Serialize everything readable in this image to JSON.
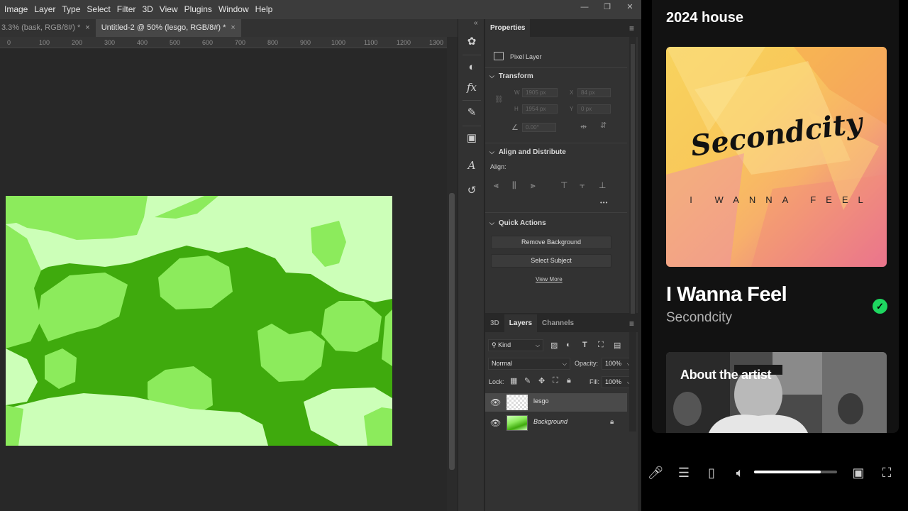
{
  "photoshop": {
    "menu": [
      "Image",
      "Layer",
      "Type",
      "Select",
      "Filter",
      "3D",
      "View",
      "Plugins",
      "Window",
      "Help"
    ],
    "window_controls": {
      "minimize": "—",
      "restore": "❐",
      "close": "✕"
    },
    "tabs": [
      {
        "label": "3.3% (bask, RGB/8#) *",
        "close": "×"
      },
      {
        "label": "Untitled-2 @ 50% (lesgo, RGB/8#) *",
        "close": "×"
      }
    ],
    "ruler_ticks": [
      "0",
      "100",
      "200",
      "300",
      "400",
      "500",
      "600",
      "700",
      "800",
      "900",
      "1000",
      "1100",
      "1200",
      "1300"
    ],
    "collapse_glyph": "«",
    "properties": {
      "tab": "Properties",
      "kind": "Pixel Layer",
      "transform": {
        "title": "Transform",
        "w_label": "W",
        "w_value": "1905 px",
        "h_label": "H",
        "h_value": "1954 px",
        "x_label": "X",
        "x_value": "84 px",
        "y_label": "Y",
        "y_value": "0 px",
        "angle_value": "0.00°"
      },
      "align": {
        "title": "Align and Distribute",
        "label": "Align:",
        "more": "•••"
      },
      "quick_actions": {
        "title": "Quick Actions",
        "remove_bg": "Remove Background",
        "select_subject": "Select Subject",
        "view_more": "View More"
      }
    },
    "layers_panel": {
      "tabs": [
        "3D",
        "Layers",
        "Channels"
      ],
      "active_tab": "Layers",
      "filter_kind": "Kind",
      "blend_mode": "Normal",
      "opacity_label": "Opacity:",
      "opacity_value": "100%",
      "lock_label": "Lock:",
      "fill_label": "Fill:",
      "fill_value": "100%",
      "layers": [
        {
          "name": "lesgo",
          "selected": true
        },
        {
          "name": "Background",
          "selected": false,
          "locked": true
        }
      ]
    },
    "colors": {
      "light_green": "#ccffb8",
      "mid_green": "#8ceb5c",
      "dark_green": "#3faa0d"
    }
  },
  "spotify": {
    "playlist_title": "2024 house",
    "cover": {
      "logo": "Secondcity",
      "subtitle": "I WANNA FEEL"
    },
    "song_title": "I Wanna Feel",
    "artist": "Secondcity",
    "liked": true,
    "about_title": "About the artist",
    "volume_fraction": 0.8,
    "controls": [
      "microphone-icon",
      "queue-icon",
      "device-icon",
      "volume-icon",
      "miniplayer-icon",
      "fullscreen-icon"
    ]
  }
}
